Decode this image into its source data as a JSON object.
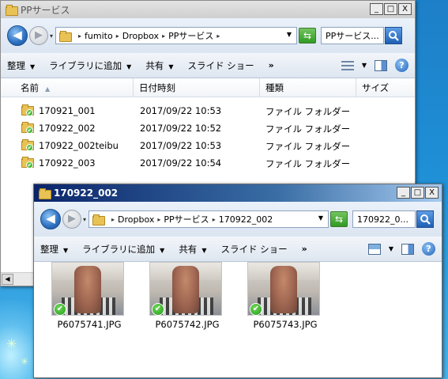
{
  "desktop": {
    "sparkle_glyph": "✳"
  },
  "window_back": {
    "title": "PPサービス",
    "caption": {
      "minimize": "_",
      "maximize": "□",
      "close": "X"
    },
    "nav": {
      "back_glyph": "◀",
      "forward_glyph": "▶",
      "history_glyph": "▾"
    },
    "breadcrumb": [
      "fumito",
      "Dropbox",
      "PPサービス"
    ],
    "search_placeholder": "PPサービス...",
    "toolbar": {
      "organize": "整理",
      "include_library": "ライブラリに追加",
      "share": "共有",
      "slideshow": "スライド ショー",
      "more": "»"
    },
    "columns": {
      "name": "名前",
      "date": "日付時刻",
      "type": "種類",
      "size": "サイズ"
    },
    "files": [
      {
        "name": "170921_001",
        "date": "2017/09/22 10:53",
        "type": "ファイル フォルダー"
      },
      {
        "name": "170922_002",
        "date": "2017/09/22 10:52",
        "type": "ファイル フォルダー"
      },
      {
        "name": "170922_002teibu",
        "date": "2017/09/22 10:53",
        "type": "ファイル フォルダー"
      },
      {
        "name": "170922_003",
        "date": "2017/09/22 10:54",
        "type": "ファイル フォルダー"
      }
    ]
  },
  "window_front": {
    "title": "170922_002",
    "caption": {
      "minimize": "_",
      "maximize": "□",
      "close": "X"
    },
    "nav": {
      "back_glyph": "◀",
      "forward_glyph": "▶",
      "history_glyph": "▾"
    },
    "breadcrumb": [
      "Dropbox",
      "PPサービス",
      "170922_002"
    ],
    "search_placeholder": "170922_0...",
    "toolbar": {
      "organize": "整理",
      "include_library": "ライブラリに追加",
      "share": "共有",
      "slideshow": "スライド ショー",
      "more": "»"
    },
    "thumbnails": [
      {
        "label": "P6075741.JPG"
      },
      {
        "label": "P6075742.JPG"
      },
      {
        "label": "P6075743.JPG"
      }
    ]
  },
  "icons": {
    "sync_check": "✔",
    "refresh": "⇆",
    "help": "?",
    "dropdown": "▼",
    "breadcrumb_sep": "▸",
    "sort_up": "▲",
    "scroll_left": "◀"
  },
  "colors": {
    "accent_blue": "#2060b8",
    "sync_green": "#249a1a",
    "folder_yellow": "#e9c256",
    "active_title": "#0a246a"
  }
}
